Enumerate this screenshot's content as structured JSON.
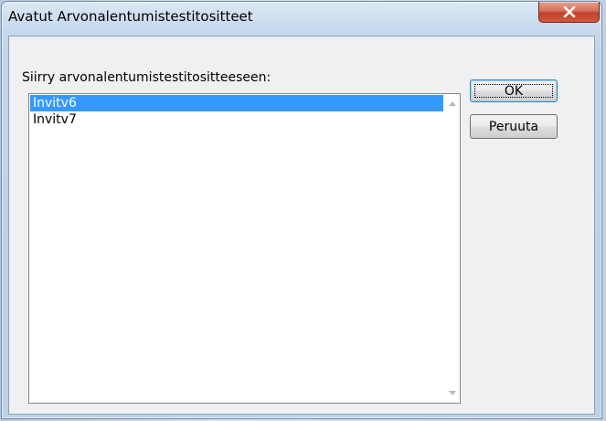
{
  "window": {
    "title": "Avatut Arvonalentumistestitositteet",
    "close_icon": "close-icon"
  },
  "dialog": {
    "prompt": "Siirry arvonalentumistestitositteeseen:",
    "list": {
      "items": [
        {
          "label": "Invitv6",
          "selected": true
        },
        {
          "label": "Invitv7",
          "selected": false
        }
      ]
    },
    "buttons": {
      "ok_label": "OK",
      "cancel_label": "Peruuta"
    }
  },
  "colors": {
    "selection": "#3399ff",
    "close_button": "#c2412a"
  }
}
